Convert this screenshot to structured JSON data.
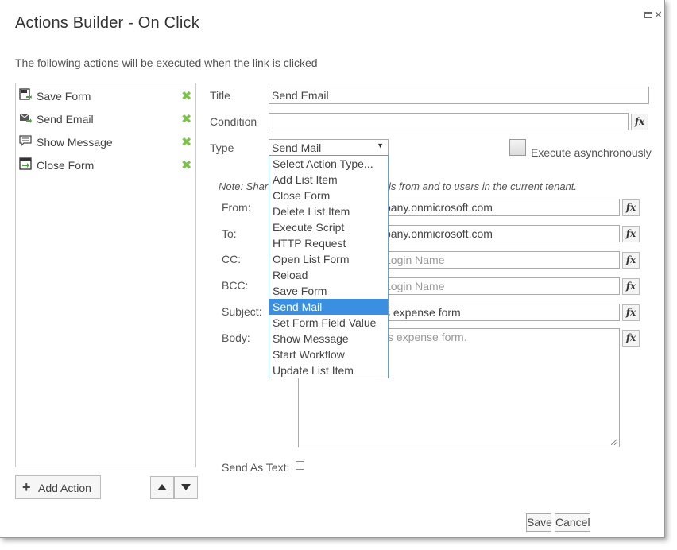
{
  "dialog": {
    "title": "Actions Builder - On Click",
    "subtitle": "The following actions will be executed when the link is clicked"
  },
  "actions": [
    {
      "label": "Save Form",
      "icon": "save-form-icon"
    },
    {
      "label": "Send Email",
      "icon": "send-email-icon"
    },
    {
      "label": "Show Message",
      "icon": "show-message-icon"
    },
    {
      "label": "Close Form",
      "icon": "close-form-icon"
    }
  ],
  "actions_footer": {
    "add_label": "Add Action"
  },
  "form": {
    "title_label": "Title",
    "title_value": "Send Email",
    "condition_label": "Condition",
    "condition_value": "",
    "type_label": "Type",
    "type_value": "Send Mail",
    "async_label": "Execute asynchronously",
    "note_left": "Note: Shar",
    "note_right": "ls from and to users in the current tenant.",
    "from_label": "From:",
    "from_value": "pany.onmicrosoft.com",
    "to_label": "To:",
    "to_value": "pany.onmicrosoft.com",
    "cc_label": "CC:",
    "cc_placeholder": "Login Name",
    "bcc_label": "BCC:",
    "bcc_placeholder": "Login Name",
    "subject_label": "Subject:",
    "subject_value": "s expense form",
    "body_label": "Body:",
    "body_value": "s expense form.",
    "send_as_text_label": "Send As Text:",
    "fx_label": "fx"
  },
  "dropdown": {
    "options": [
      "Select Action Type...",
      "Add List Item",
      "Close Form",
      "Delete List Item",
      "Execute Script",
      "HTTP Request",
      "Open List Form",
      "Reload",
      "Save Form",
      "Send Mail",
      "Set Form Field Value",
      "Show Message",
      "Start Workflow",
      "Update List Item"
    ],
    "selected": "Send Mail"
  },
  "footer": {
    "save_label": "Save",
    "cancel_label": "Cancel"
  },
  "colors": {
    "accent": "#3b8fe0",
    "delete_green": "#7cc24a"
  }
}
